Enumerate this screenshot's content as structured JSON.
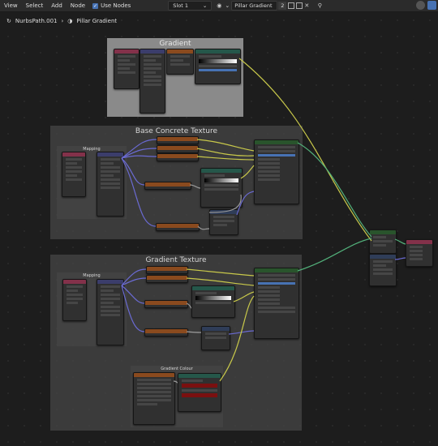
{
  "menu": {
    "view": "View",
    "select": "Select",
    "add": "Add",
    "node": "Node"
  },
  "use_nodes": {
    "label": "Use Nodes",
    "checked": true
  },
  "slot": {
    "label": "Slot 1"
  },
  "material": {
    "name": "Pillar Gradient",
    "users": "2"
  },
  "breadcrumb": {
    "object": "NurbsPath.001",
    "material": "Pillar Gradient"
  },
  "frames": {
    "gradient": "Gradient",
    "base_concrete": "Base Concrete Texture",
    "gradient_texture": "Gradient Texture",
    "gradient_colour": "Gradient Colour",
    "mapping_1": "Mapping",
    "mapping_2": "Mapping"
  },
  "colors": {
    "accent": "#4772b3",
    "wire_yellow": "#c8c84a",
    "wire_green": "#52b07a",
    "wire_purple": "#6a6ad2"
  },
  "icons": [
    "refresh-icon",
    "sphere-icon",
    "shield-icon",
    "copy-icon",
    "delete-icon",
    "pin-icon",
    "overlay-icon",
    "camera-icon"
  ]
}
